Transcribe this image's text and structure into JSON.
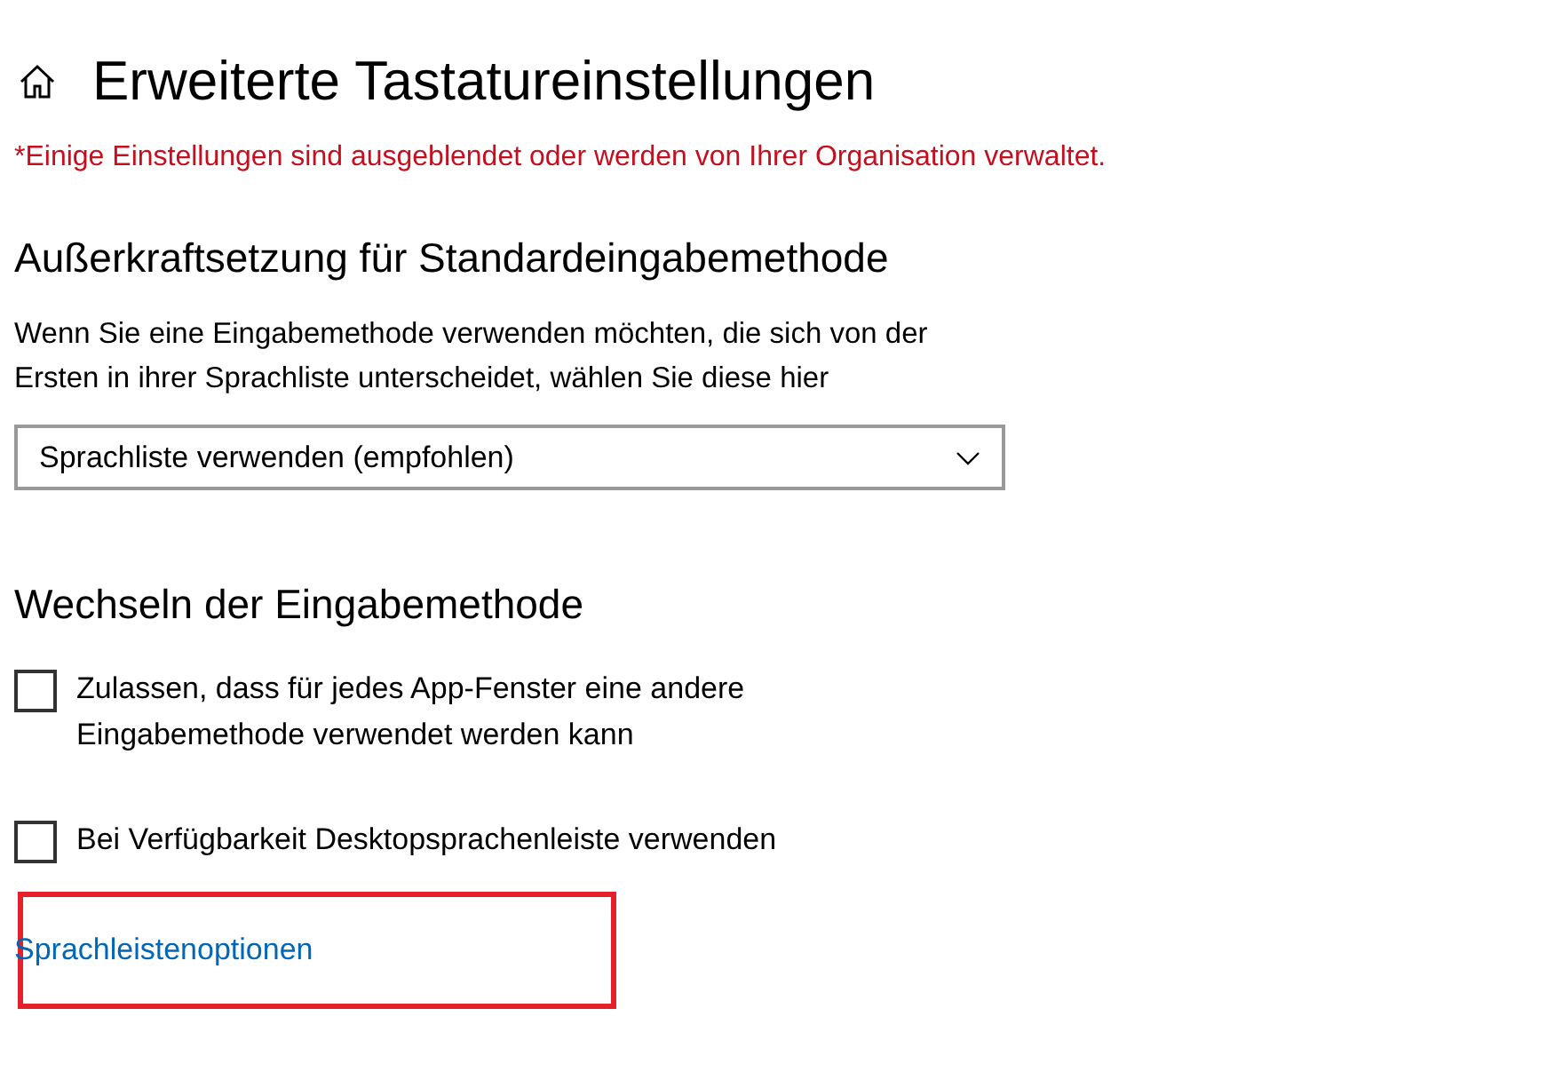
{
  "header": {
    "title": "Erweiterte Tastatureinstellungen"
  },
  "notice": "*Einige Einstellungen sind ausgeblendet oder werden von Ihrer Organisation verwaltet.",
  "sections": [
    {
      "heading": "Außerkraftsetzung für Standardeingabemethode",
      "description": "Wenn Sie eine Eingabemethode verwenden möchten, die sich von der Ersten in ihrer Sprachliste unterscheidet, wählen Sie diese hier",
      "dropdown": {
        "value": "Sprachliste verwenden (empfohlen)"
      }
    },
    {
      "heading": "Wechseln der Eingabemethode",
      "checkboxes": [
        {
          "label": "Zulassen, dass für jedes App-Fenster eine andere Eingabemethode verwendet werden kann",
          "checked": false
        },
        {
          "label": "Bei Verfügbarkeit Desktopsprachenleiste verwenden",
          "checked": false
        }
      ],
      "link": {
        "label": "Sprachleistenoptionen",
        "highlighted": true
      }
    }
  ]
}
